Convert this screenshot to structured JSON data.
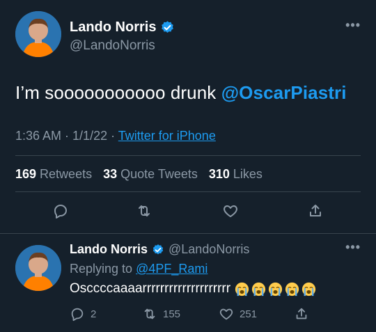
{
  "main_tweet": {
    "author_name": "Lando Norris",
    "author_handle": "@LandoNorris",
    "text": "I’m sooooooooooo drunk ",
    "mention": "@OscarPiastri",
    "time": "1:36 AM",
    "date": "1/1/22",
    "meta_sep1": " · ",
    "meta_sep2": " · ",
    "source": "Twitter for iPhone",
    "stats": {
      "retweets_count": "169",
      "retweets_label": "Retweets",
      "quotes_count": "33",
      "quotes_label": "Quote Tweets",
      "likes_count": "310",
      "likes_label": "Likes"
    },
    "more": "•••"
  },
  "reply_tweet": {
    "author_name": "Lando Norris",
    "author_handle": "@LandoNorris",
    "replying_prefix": "Replying to ",
    "replying_to": "@4PF_Rami",
    "text": "Osccccaaaarrrrrrrrrrrrrrrrrrrr",
    "emoji_name": "loudly-crying-face",
    "emoji_count": 5,
    "replies": "2",
    "retweets": "155",
    "likes": "251",
    "more": "•••"
  },
  "colors": {
    "background": "#15202b",
    "accent": "#1d9bf0",
    "muted": "#8b98a5",
    "divider": "#38444d"
  }
}
